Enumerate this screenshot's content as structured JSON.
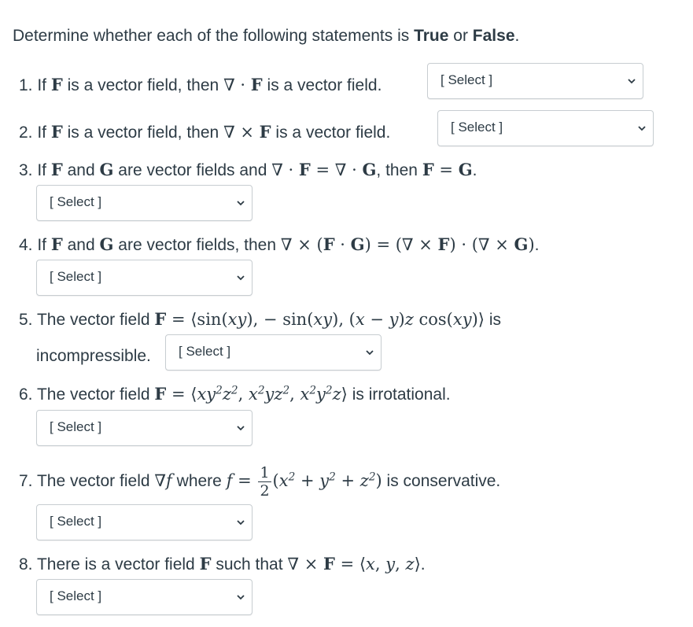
{
  "intro": {
    "prefix": "Determine whether each of the following statements is ",
    "true_word": "True",
    "or_word": " or ",
    "false_word": "False",
    "suffix": "."
  },
  "select_placeholder": "[ Select ]",
  "questions": [
    {
      "number": "1.",
      "text": "If F is a vector field, then ∇ · F is a vector field."
    },
    {
      "number": "2.",
      "text": "If F is a vector field, then ∇ × F is a vector field."
    },
    {
      "number": "3.",
      "text": "If F and G are vector fields and ∇ · F = ∇ · G, then F = G."
    },
    {
      "number": "4.",
      "text": "If F and G are vector fields, then ∇ × (F · G) = (∇ × F) · (∇ × G)."
    },
    {
      "number": "5.",
      "text": "The vector field F = ⟨sin(xy), − sin(xy), (x − y)z cos(xy)⟩ is incompressible."
    },
    {
      "number": "6.",
      "text": "The vector field F = ⟨xy²z², x²yz², x²y²z⟩ is irrotational."
    },
    {
      "number": "7.",
      "text": "The vector field ∇f where f = 1/2 (x² + y² + z²) is conservative."
    },
    {
      "number": "8.",
      "text": "There is a vector field F such that ∇ × F = ⟨x, y, z⟩."
    }
  ],
  "icons": {
    "dropdown": "chevron-down-icon"
  }
}
